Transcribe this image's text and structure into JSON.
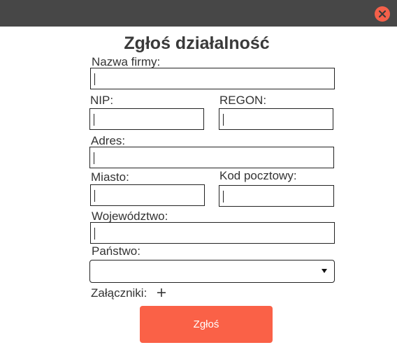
{
  "window": {
    "close_icon": "close-icon",
    "accent_color": "#f4604a",
    "topbar_color": "#474747"
  },
  "form": {
    "title": "Zgłoś działalność",
    "fields": {
      "company_name": {
        "label": "Nazwa firmy:",
        "value": ""
      },
      "nip": {
        "label": "NIP:",
        "value": ""
      },
      "regon": {
        "label": "REGON:",
        "value": ""
      },
      "address": {
        "label": "Adres:",
        "value": ""
      },
      "city": {
        "label": "Miasto:",
        "value": ""
      },
      "postal_code": {
        "label": "Kod pocztowy:",
        "value": ""
      },
      "voivodeship": {
        "label": "Województwo:",
        "value": ""
      },
      "country": {
        "label": "Państwo:",
        "selected": ""
      }
    },
    "attachments": {
      "label": "Załączniki:",
      "add_icon": "plus-icon"
    },
    "submit_label": "Zgłoś",
    "submit_color": "#fa6147"
  }
}
